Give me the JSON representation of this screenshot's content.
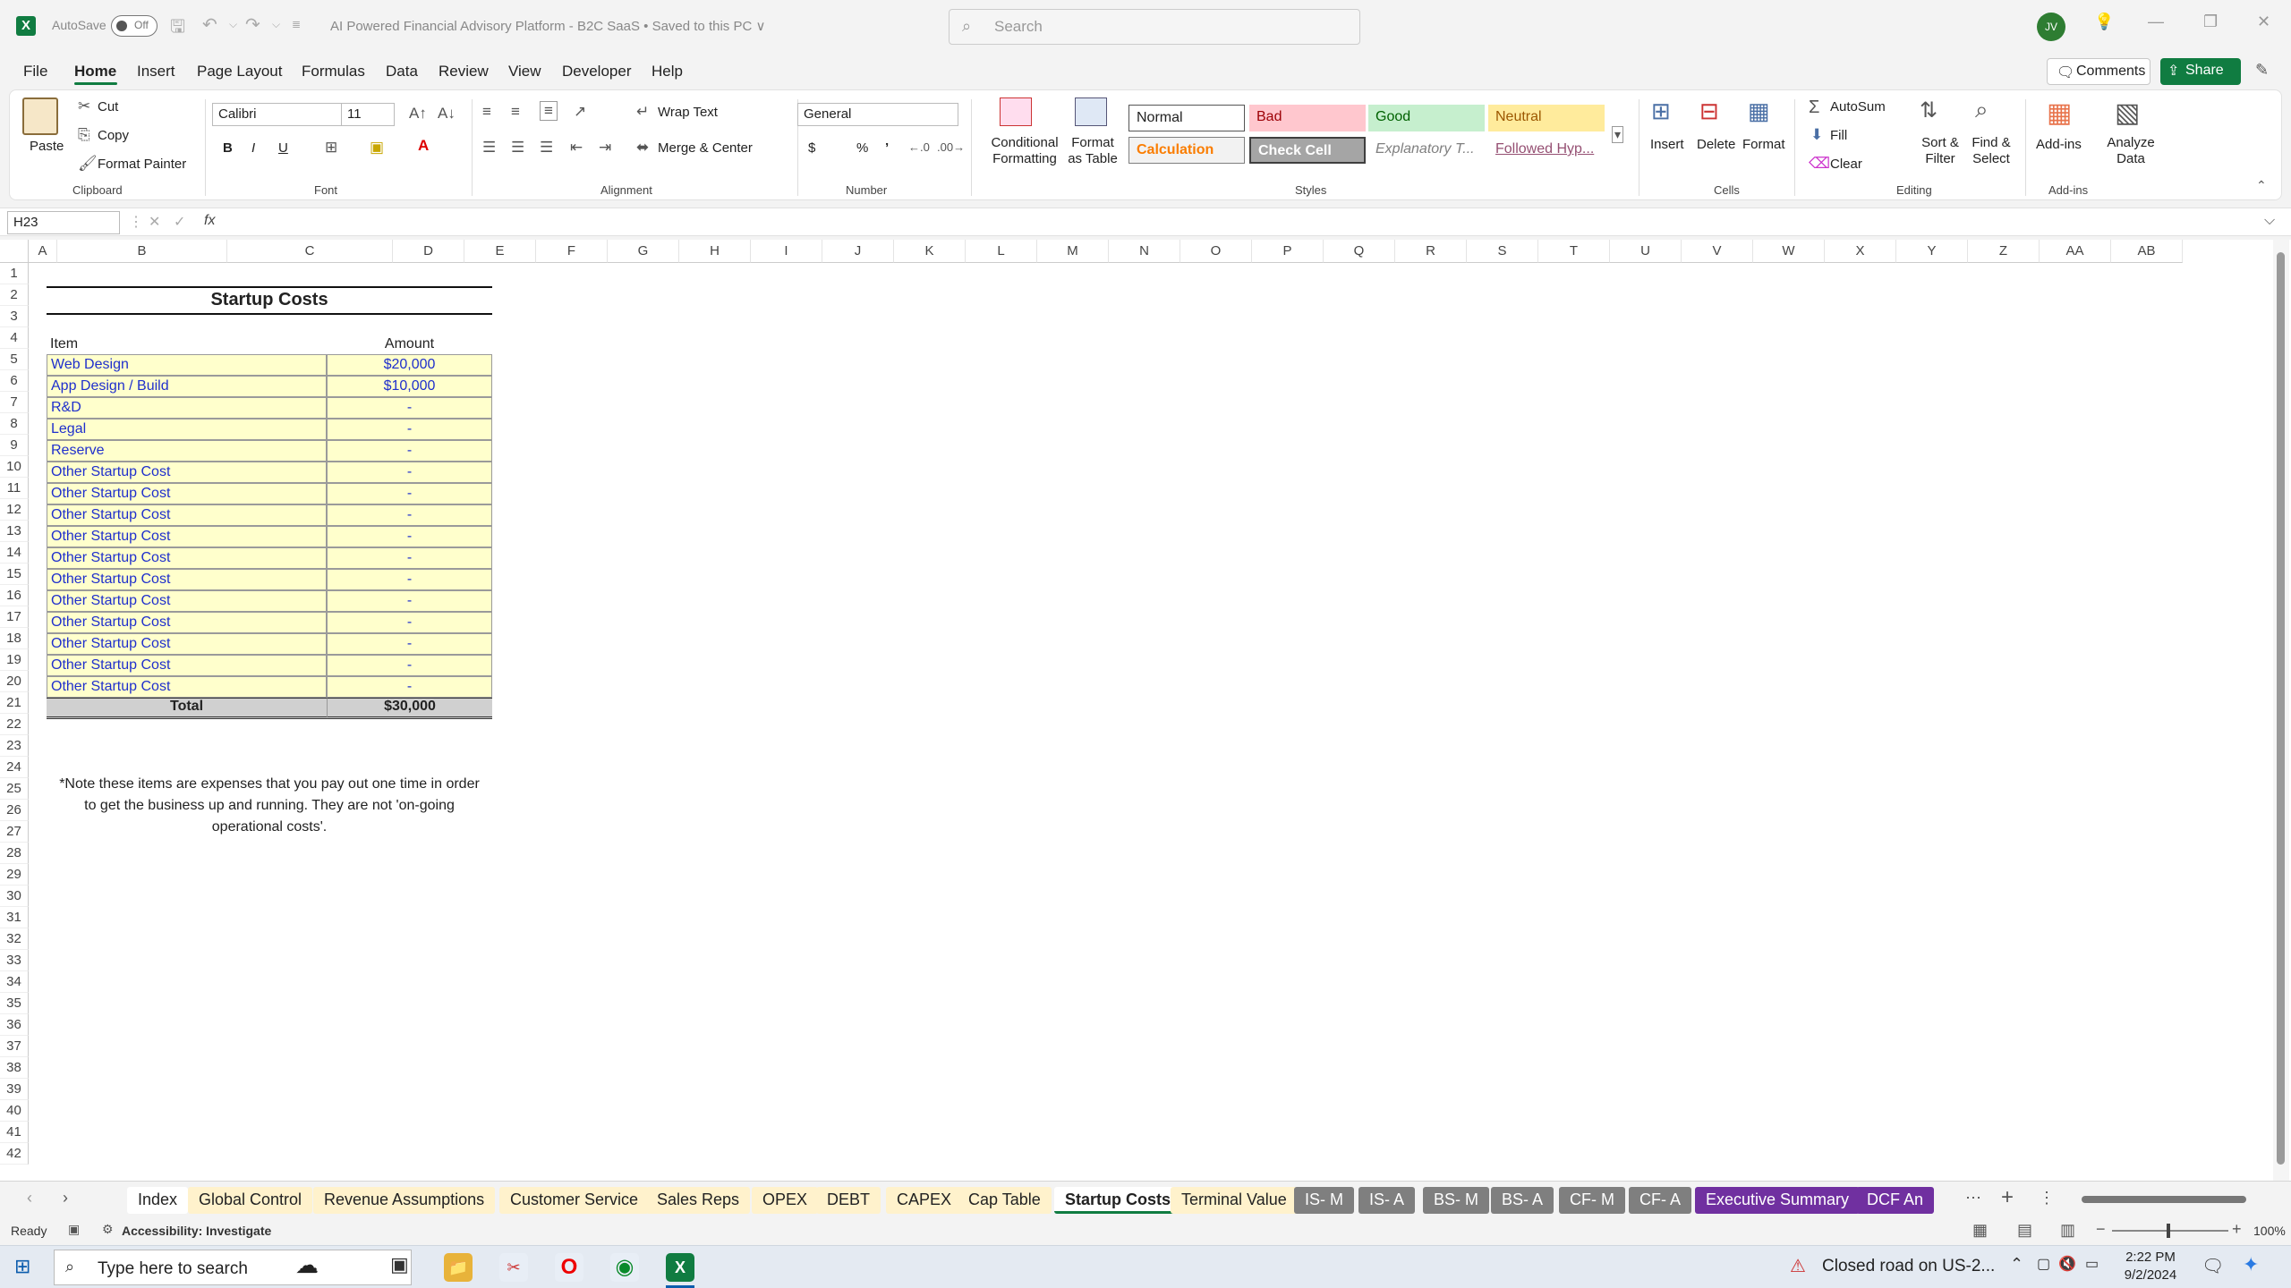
{
  "titlebar": {
    "autosave_label": "AutoSave",
    "autosave_state": "Off",
    "doc_title": "AI Powered Financial Advisory Platform - B2C SaaS  •  Saved to this PC ∨",
    "search_placeholder": "Search",
    "avatar_initials": "JV"
  },
  "menu": {
    "file": "File",
    "home": "Home",
    "insert": "Insert",
    "page_layout": "Page Layout",
    "formulas": "Formulas",
    "data": "Data",
    "review": "Review",
    "view": "View",
    "developer": "Developer",
    "help": "Help",
    "comments": "Comments",
    "share": "Share"
  },
  "ribbon": {
    "clipboard": {
      "label": "Clipboard",
      "paste": "Paste",
      "cut": "Cut",
      "copy": "Copy",
      "format_painter": "Format Painter"
    },
    "font": {
      "label": "Font",
      "name": "Calibri",
      "size": "11",
      "bold": "B",
      "italic": "I",
      "underline": "U"
    },
    "alignment": {
      "label": "Alignment",
      "wrap_text": "Wrap Text",
      "merge_center": "Merge & Center"
    },
    "number": {
      "label": "Number",
      "format": "General",
      "currency": "$",
      "percent": "%",
      "comma": "’"
    },
    "styles": {
      "label": "Styles",
      "conditional": "Conditional Formatting",
      "format_table": "Format as Table",
      "normal": "Normal",
      "bad": "Bad",
      "good": "Good",
      "neutral": "Neutral",
      "calculation": "Calculation",
      "check_cell": "Check Cell",
      "explanatory": "Explanatory T...",
      "followed": "Followed Hyp..."
    },
    "cells": {
      "label": "Cells",
      "insert": "Insert",
      "delete": "Delete",
      "format": "Format"
    },
    "editing": {
      "label": "Editing",
      "autosum": "AutoSum",
      "fill": "Fill",
      "clear": "Clear",
      "sort_filter": "Sort & Filter",
      "find_select": "Find & Select"
    },
    "addins": {
      "label": "Add-ins",
      "addins": "Add-ins",
      "analyze": "Analyze Data"
    }
  },
  "formula_bar": {
    "name_box": "H23",
    "fx": "fx",
    "content": ""
  },
  "grid": {
    "columns": [
      "A",
      "B",
      "C",
      "D",
      "E",
      "F",
      "G",
      "H",
      "I",
      "J",
      "K",
      "L",
      "M",
      "N",
      "O",
      "P",
      "Q",
      "R",
      "S",
      "T",
      "U",
      "V",
      "W",
      "X",
      "Y",
      "Z",
      "AA",
      "AB"
    ],
    "rows": [
      "1",
      "2",
      "3",
      "4",
      "5",
      "6",
      "7",
      "8",
      "9",
      "10",
      "11",
      "12",
      "13",
      "14",
      "15",
      "16",
      "17",
      "18",
      "19",
      "20",
      "21",
      "22",
      "23",
      "24",
      "25",
      "26",
      "27",
      "28",
      "29",
      "30",
      "31",
      "32",
      "33",
      "34",
      "35",
      "36",
      "37",
      "38",
      "39",
      "40",
      "41",
      "42"
    ]
  },
  "sheet": {
    "title": "Startup Costs",
    "header_item": "Item",
    "header_amount": "Amount",
    "items": [
      {
        "name": "Web Design",
        "amount": "$20,000"
      },
      {
        "name": "App Design / Build",
        "amount": "$10,000"
      },
      {
        "name": "R&D",
        "amount": "-"
      },
      {
        "name": "Legal",
        "amount": "-"
      },
      {
        "name": "Reserve",
        "amount": "-"
      },
      {
        "name": "Other Startup Cost",
        "amount": "-"
      },
      {
        "name": "Other Startup Cost",
        "amount": "-"
      },
      {
        "name": "Other Startup Cost",
        "amount": "-"
      },
      {
        "name": "Other Startup Cost",
        "amount": "-"
      },
      {
        "name": "Other Startup Cost",
        "amount": "-"
      },
      {
        "name": "Other Startup Cost",
        "amount": "-"
      },
      {
        "name": "Other Startup Cost",
        "amount": "-"
      },
      {
        "name": "Other Startup Cost",
        "amount": "-"
      },
      {
        "name": "Other Startup Cost",
        "amount": "-"
      },
      {
        "name": "Other Startup Cost",
        "amount": "-"
      },
      {
        "name": "Other Startup Cost",
        "amount": "-"
      }
    ],
    "total_label": "Total",
    "total_value": "$30,000",
    "note_line1": "*Note these items are expenses that you pay out one time in order",
    "note_line2": "to get the business up and running. They are not 'on-going",
    "note_line3": "operational costs'."
  },
  "tabs": [
    {
      "label": "Index",
      "style": "white"
    },
    {
      "label": "Global Control",
      "style": "yellow"
    },
    {
      "label": "Revenue Assumptions",
      "style": "yellow"
    },
    {
      "label": "Customer Service",
      "style": "yellow"
    },
    {
      "label": "Sales Reps",
      "style": "yellow"
    },
    {
      "label": "OPEX",
      "style": "yellow"
    },
    {
      "label": "DEBT",
      "style": "yellow"
    },
    {
      "label": "CAPEX",
      "style": "yellow"
    },
    {
      "label": "Cap Table",
      "style": "yellow"
    },
    {
      "label": "Startup Costs",
      "style": "active"
    },
    {
      "label": "Terminal Value",
      "style": "yellow"
    },
    {
      "label": "IS- M",
      "style": "gray"
    },
    {
      "label": "IS- A",
      "style": "gray"
    },
    {
      "label": "BS- M",
      "style": "gray"
    },
    {
      "label": "BS- A",
      "style": "gray"
    },
    {
      "label": "CF- M",
      "style": "gray"
    },
    {
      "label": "CF- A",
      "style": "gray"
    },
    {
      "label": "Executive Summary",
      "style": "purple"
    },
    {
      "label": "DCF An",
      "style": "purple"
    }
  ],
  "status": {
    "ready": "Ready",
    "accessibility": "Accessibility: Investigate",
    "zoom": "100%"
  },
  "taskbar": {
    "search_placeholder": "Type here to search",
    "news": "Closed road on US-2...",
    "time": "2:22 PM",
    "date": "9/2/2024"
  },
  "colors": {
    "excel_green": "#107c41",
    "input_yellow": "#ffffcc",
    "input_blue": "#1f2fcc"
  }
}
